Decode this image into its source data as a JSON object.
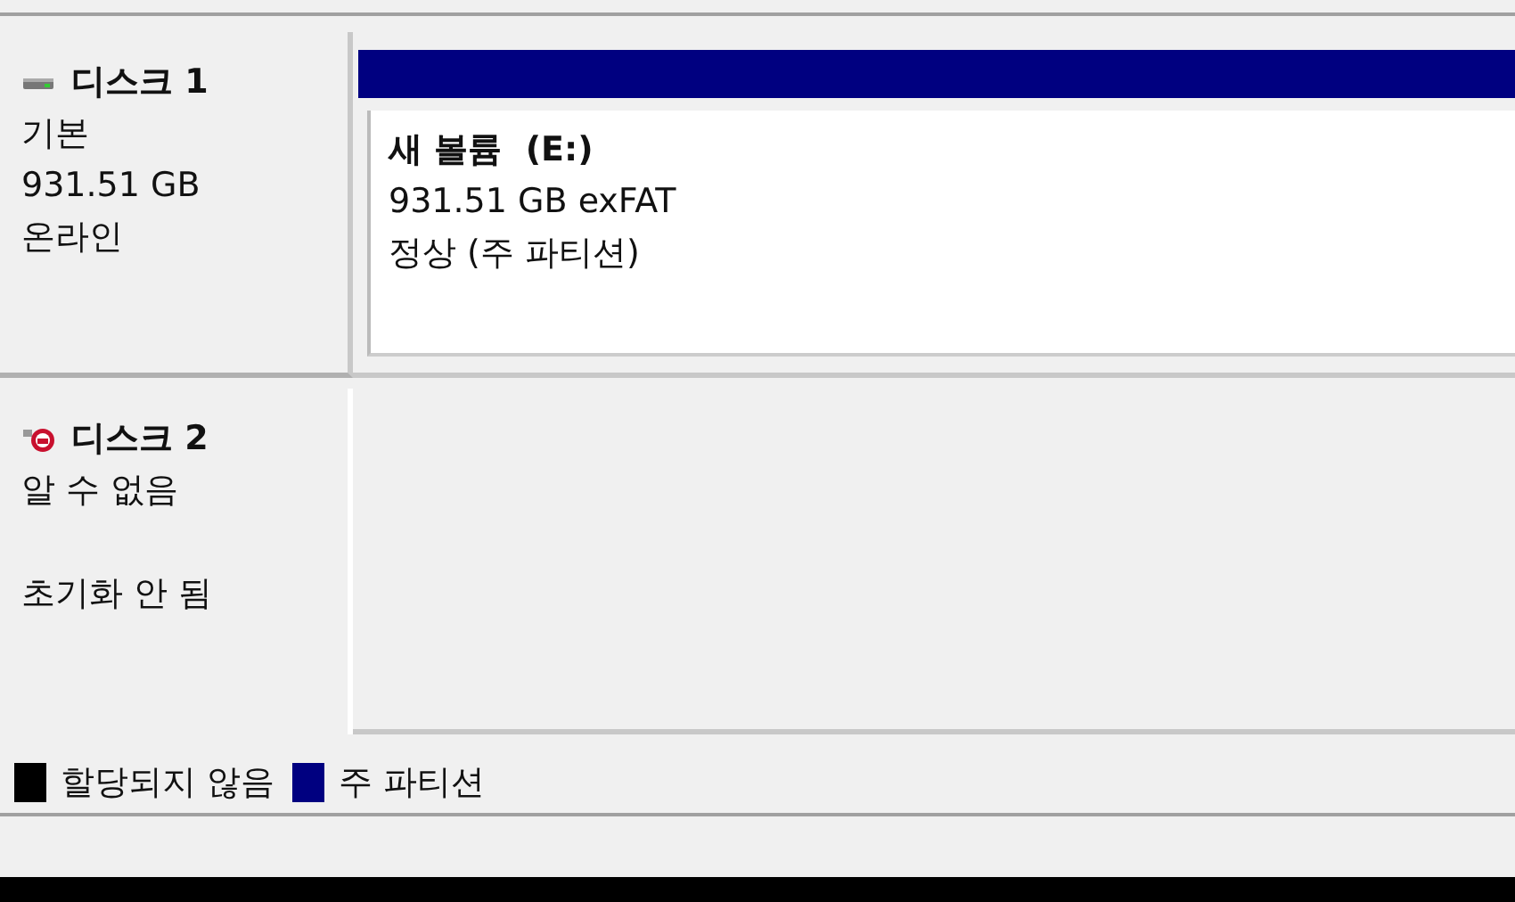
{
  "disks": [
    {
      "kind": "online",
      "name": "디스크 1",
      "type": "기본",
      "size": "931.51 GB",
      "status": "온라인",
      "partitions": [
        {
          "color": "#000080",
          "title": "새 볼륨  (E:)",
          "lines": [
            "931.51 GB exFAT",
            "정상 (주 파티션)"
          ]
        }
      ]
    },
    {
      "kind": "error",
      "name": "디스크 2",
      "type": "알 수 없음",
      "status": "초기화 안 됨"
    }
  ],
  "legend": [
    {
      "label": "할당되지 않음",
      "color": "#000000"
    },
    {
      "label": "주 파티션",
      "color": "#000080"
    }
  ]
}
